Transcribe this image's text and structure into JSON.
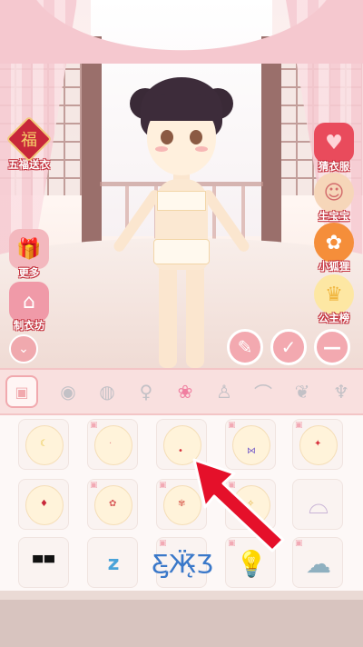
{
  "left_menu": [
    {
      "label": "五福送衣",
      "icon": "fu-charm-icon",
      "glyph": "福"
    },
    {
      "label": "更多",
      "icon": "bag-icon",
      "glyph": "🎁"
    },
    {
      "label": "制衣坊",
      "icon": "shop-icon",
      "glyph": "⌂"
    }
  ],
  "right_menu": [
    {
      "label": "猜衣服",
      "icon": "clothes-heart-icon",
      "glyph": "♥"
    },
    {
      "label": "生宝宝",
      "icon": "baby-icon",
      "glyph": "☺"
    },
    {
      "label": "小狐狸",
      "icon": "fox-icon",
      "glyph": "✿"
    },
    {
      "label": "公主榜",
      "icon": "crown-icon",
      "glyph": "♛"
    }
  ],
  "action_buttons": {
    "clean": "✎",
    "confirm": "✓",
    "remove": "—",
    "fold": "⌄"
  },
  "categories": [
    {
      "icon": "wardrobe-icon",
      "glyph": "▣"
    },
    {
      "icon": "eyes-icon",
      "glyph": "◉"
    },
    {
      "icon": "hair-icon",
      "glyph": "◍"
    },
    {
      "icon": "hairstyle-icon",
      "glyph": "♀"
    },
    {
      "icon": "lotus-icon",
      "glyph": "❀"
    },
    {
      "icon": "dress-icon",
      "glyph": "♙"
    },
    {
      "icon": "shoes-icon",
      "glyph": "⌒"
    },
    {
      "icon": "accessory-icon",
      "glyph": "❦"
    },
    {
      "icon": "wings-icon",
      "glyph": "♆"
    }
  ],
  "selected_category_index": 4,
  "items": [
    {
      "name": "moon-mark-item",
      "mark": "☾",
      "color": "#e6c23a",
      "camera": false
    },
    {
      "name": "dots-mark-item",
      "mark": "·",
      "color": "#e58a8a",
      "camera": true
    },
    {
      "name": "red-dot-mark-item",
      "mark": "•",
      "color": "#d8323e",
      "camera": false
    },
    {
      "name": "butterfly-mark-item",
      "mark": "⋈",
      "color": "#7b62c9",
      "camera": true
    },
    {
      "name": "star-mark-item",
      "mark": "✦",
      "color": "#d8323e",
      "camera": true
    },
    {
      "name": "drop-mark-item",
      "mark": "♦",
      "color": "#c8273a",
      "camera": false
    },
    {
      "name": "flower-mark-item",
      "mark": "✿",
      "color": "#d85a5a",
      "camera": true
    },
    {
      "name": "flower2-mark-item",
      "mark": "✾",
      "color": "#e07a6a",
      "camera": true
    },
    {
      "name": "gold-mark-item",
      "mark": "✧",
      "color": "#e6b33a",
      "camera": true
    },
    {
      "name": "collar-item",
      "mark": "⌓",
      "color": "#c9b4d6",
      "camera": false
    },
    {
      "name": "sunglasses-item",
      "mark": "▀▀",
      "color": "#111111",
      "camera": false
    },
    {
      "name": "zzz-item",
      "mark": "z",
      "color": "#4aa3d9",
      "camera": false
    },
    {
      "name": "butterfly-item",
      "mark": "Ƹ̵̡Ӝ̵̨̄Ʒ",
      "color": "#3a78c9",
      "camera": true
    },
    {
      "name": "lightbulb-item",
      "mark": "💡",
      "color": "#f2c94c",
      "camera": true
    },
    {
      "name": "scribble-item",
      "mark": "☁",
      "color": "#8fb0c0",
      "camera": true
    }
  ],
  "colors": {
    "accent": "#f3a9b0",
    "pointer": "#e5102a"
  }
}
